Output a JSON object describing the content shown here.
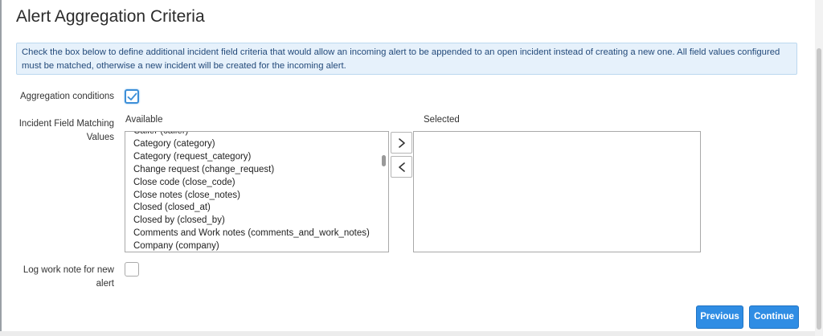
{
  "title": "Alert Aggregation Criteria",
  "info_text": "Check the box below to define additional incident field criteria that would allow an incoming alert to be appended to an open incident instead of creating a new one. All field values configured must be matched, otherwise a new incident will be created for the incoming alert.",
  "aggregation": {
    "label": "Aggregation conditions",
    "checked": true
  },
  "matching": {
    "label": "Incident Field Matching Values",
    "available_header": "Available",
    "selected_header": "Selected",
    "available_items": [
      "Caller (caller)",
      "Category (category)",
      "Category (request_category)",
      "Change request (change_request)",
      "Close code (close_code)",
      "Close notes (close_notes)",
      "Closed (closed_at)",
      "Closed by (closed_by)",
      "Comments and Work notes (comments_and_work_notes)",
      "Company (company)"
    ],
    "selected_items": [],
    "add_icon": "chevron-right-icon",
    "remove_icon": "chevron-left-icon"
  },
  "log_work_note": {
    "label": "Log work note for new alert",
    "checked": false
  },
  "buttons": {
    "previous": "Previous",
    "continue": "Continue"
  },
  "colors": {
    "primary_button": "#2f8de4",
    "info_background": "#e6f1fb",
    "info_text": "#234a7a",
    "checkbox_accent": "#3d8fd8"
  }
}
